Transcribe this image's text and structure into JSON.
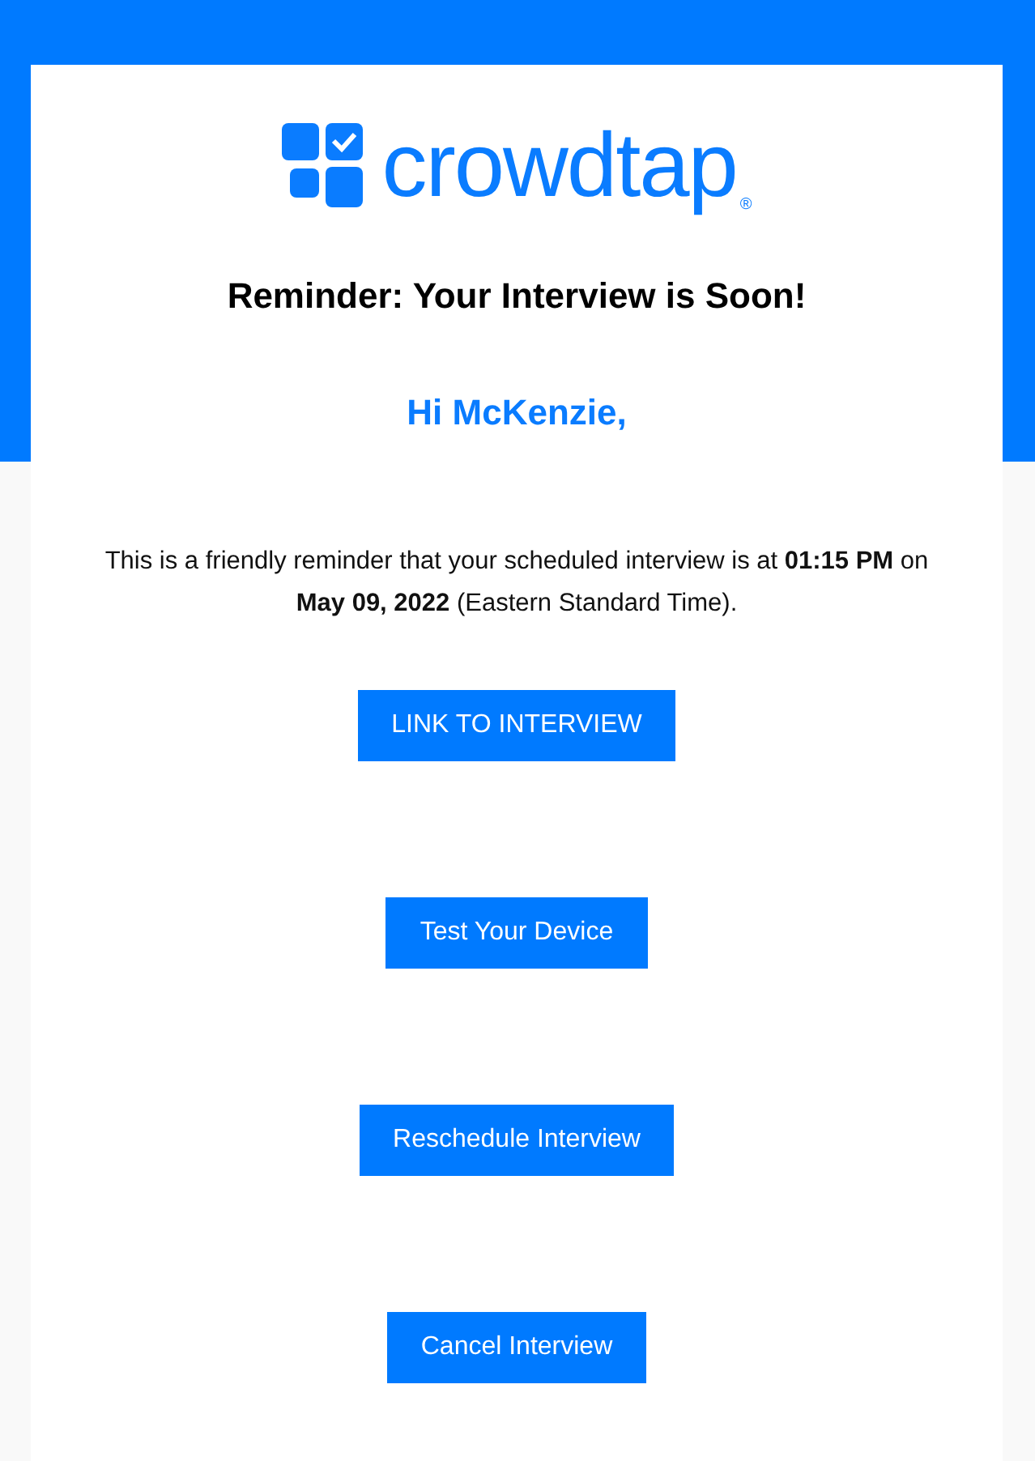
{
  "logo": {
    "text": "crowdtap",
    "mark": "®"
  },
  "heading": "Reminder: Your Interview is Soon!",
  "greeting": "Hi McKenzie,",
  "message": "This is a friendly reminder that your scheduled interview is at **01:15 PM** on **May 09, 2022** (Eastern Standard Time).",
  "buttons": [
    {
      "label": "LINK TO INTERVIEW"
    },
    {
      "label": "Test Your Device"
    },
    {
      "label": "Reschedule Interview"
    },
    {
      "label": "Cancel Interview"
    }
  ]
}
